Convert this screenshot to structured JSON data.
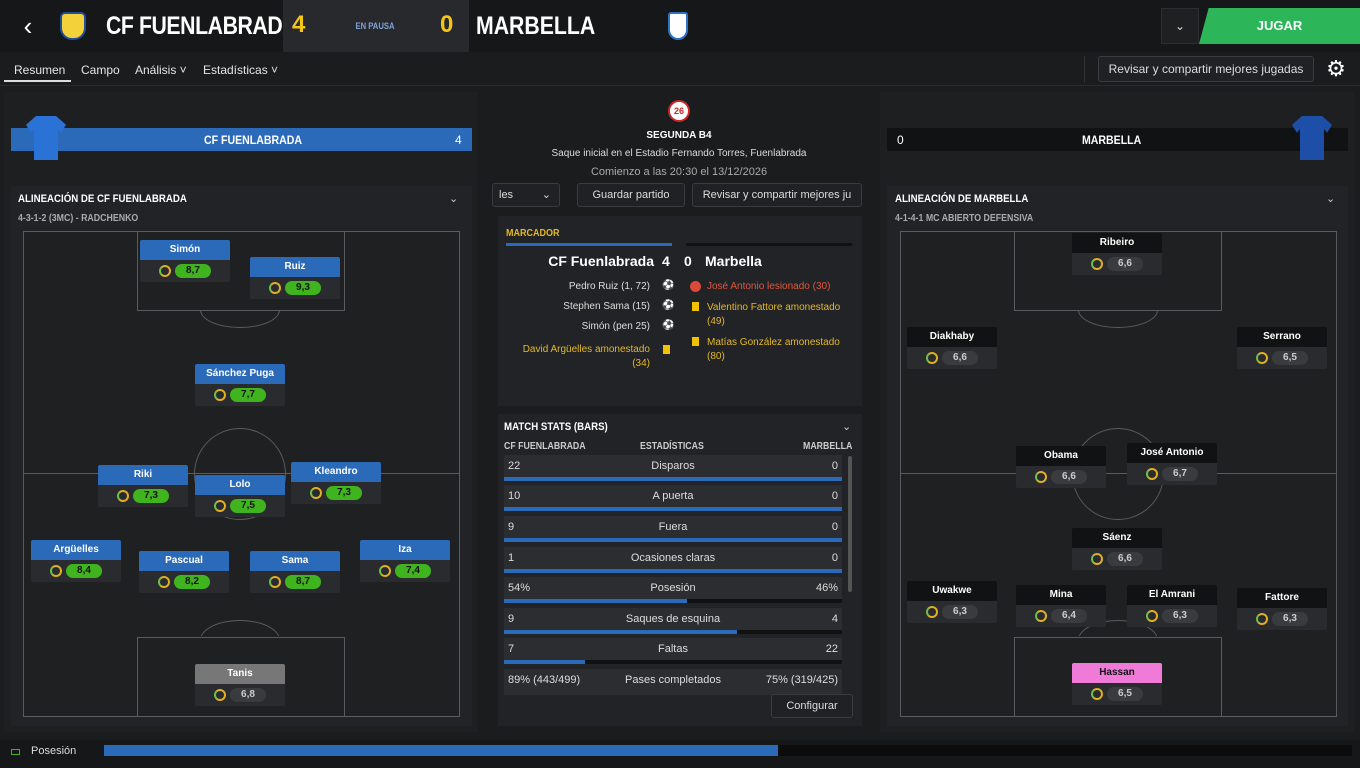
{
  "header": {
    "home_team": "CF FUENLABRADA",
    "home_score": "4",
    "status": "EN PAUSA",
    "away_score": "0",
    "away_team": "MARBELLA",
    "play_label": "JUGAR",
    "back": "‹"
  },
  "tabs": [
    {
      "label": "Resumen"
    },
    {
      "label": "Campo"
    },
    {
      "label": "Análisis ˅"
    },
    {
      "label": "Estadísticas ˅"
    }
  ],
  "toolbar": {
    "review_label": "Revisar y compartir mejores jugadas"
  },
  "home": {
    "bar_name": "CF FUENLABRADA",
    "bar_score": "4",
    "lineup_title": "ALINEACIÓN DE CF FUENLABRADA",
    "formation": "4-3-1-2 (3MC) - RADCHENKO",
    "players": [
      {
        "name": "Simón",
        "rating": "8,7"
      },
      {
        "name": "Ruiz",
        "rating": "9,3"
      },
      {
        "name": "Sánchez Puga",
        "rating": "7,7"
      },
      {
        "name": "Riki",
        "rating": "7,3"
      },
      {
        "name": "Lolo",
        "rating": "7,5"
      },
      {
        "name": "Kleandro",
        "rating": "7,3"
      },
      {
        "name": "Argüelles",
        "rating": "8,4"
      },
      {
        "name": "Pascual",
        "rating": "8,2"
      },
      {
        "name": "Sama",
        "rating": "8,7"
      },
      {
        "name": "Iza",
        "rating": "7,4"
      },
      {
        "name": "Tanis",
        "rating": "6,8"
      }
    ]
  },
  "away": {
    "bar_name": "MARBELLA",
    "bar_score": "0",
    "lineup_title": "ALINEACIÓN DE MARBELLA",
    "formation": "4-1-4-1 MC ABIERTO DEFENSIVA",
    "players": [
      {
        "name": "Ribeiro",
        "rating": "6,6"
      },
      {
        "name": "Diakhaby",
        "rating": "6,6"
      },
      {
        "name": "Serrano",
        "rating": "6,5"
      },
      {
        "name": "Obama",
        "rating": "6,6"
      },
      {
        "name": "José Antonio",
        "rating": "6,7"
      },
      {
        "name": "Sáenz",
        "rating": "6,6"
      },
      {
        "name": "Uwakwe",
        "rating": "6,3"
      },
      {
        "name": "Mina",
        "rating": "6,4"
      },
      {
        "name": "El Amrani",
        "rating": "6,3"
      },
      {
        "name": "Fattore",
        "rating": "6,3"
      },
      {
        "name": "Hassan",
        "rating": "6,5"
      }
    ]
  },
  "match": {
    "competition_icon": "26",
    "competition": "SEGUNDA B4",
    "venue": "Saque inicial en el Estadio Fernando Torres, Fuenlabrada",
    "kickoff": "Comienzo a las 20:30 el 13/12/2026",
    "highlights_dd": "les",
    "save_label": "Guardar partido",
    "review_short": "Revisar y compartir mejores ju"
  },
  "scoreboard": {
    "title": "MARCADOR",
    "home": "CF Fuenlabrada",
    "home_score": "4",
    "away_score": "0",
    "away": "Marbella",
    "home_events": [
      {
        "text": "Pedro Ruiz (1, 72)",
        "type": "goal"
      },
      {
        "text": "Stephen Sama (15)",
        "type": "goal"
      },
      {
        "text": "Simón (pen 25)",
        "type": "goal"
      },
      {
        "text": "David Argüelles amonestado (34)",
        "type": "yellow"
      }
    ],
    "away_events": [
      {
        "text": "José Antonio lesionado (30)",
        "type": "injury"
      },
      {
        "text": "Valentino Fattore amonestado (49)",
        "type": "yellow"
      },
      {
        "text": "Matías González amonestado (80)",
        "type": "yellow"
      }
    ]
  },
  "stats": {
    "title": "MATCH STATS (BARS)",
    "home_col": "CF FUENLABRADA",
    "mid_col": "ESTADÍSTICAS",
    "away_col": "MARBELLA",
    "configure": "Configurar",
    "rows": [
      {
        "label": "Disparos",
        "home": "22",
        "away": "0",
        "home_frac": 1.0
      },
      {
        "label": "A puerta",
        "home": "10",
        "away": "0",
        "home_frac": 1.0
      },
      {
        "label": "Fuera",
        "home": "9",
        "away": "0",
        "home_frac": 1.0
      },
      {
        "label": "Ocasiones claras",
        "home": "1",
        "away": "0",
        "home_frac": 1.0
      },
      {
        "label": "Posesión",
        "home": "54%",
        "away": "46%",
        "home_frac": 0.54
      },
      {
        "label": "Saques de esquina",
        "home": "9",
        "away": "4",
        "home_frac": 0.69
      },
      {
        "label": "Faltas",
        "home": "7",
        "away": "22",
        "home_frac": 0.24
      },
      {
        "label": "Pases completados",
        "home": "89% (443/499)",
        "away": "75% (319/425)",
        "home_frac": 0.0
      }
    ]
  },
  "bottom": {
    "label": "Posesión",
    "home_possession": 0.54
  },
  "colors": {
    "home": "#2b6ab8",
    "accent": "#f5c518",
    "play": "#2db55a"
  }
}
